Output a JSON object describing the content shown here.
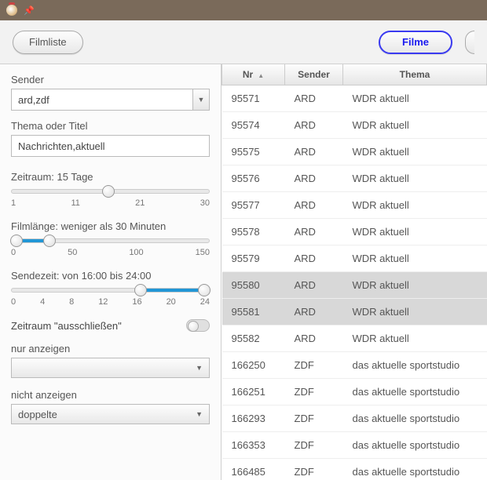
{
  "toolbar": {
    "filmliste_label": "Filmliste",
    "filme_label": "Filme"
  },
  "filters": {
    "sender_label": "Sender",
    "sender_value": "ard,zdf",
    "thema_label": "Thema oder Titel",
    "thema_value": "Nachrichten,aktuell",
    "zeitraum_label": "Zeitraum: 15 Tage",
    "zeitraum_ticks": [
      "1",
      "11",
      "21",
      "30"
    ],
    "filmlaenge_label": "Filmlänge: weniger als 30 Minuten",
    "filmlaenge_ticks": [
      "0",
      "50",
      "100",
      "150"
    ],
    "sendezeit_label": "Sendezeit: von 16:00 bis 24:00",
    "sendezeit_ticks": [
      "0",
      "4",
      "8",
      "12",
      "16",
      "20",
      "24"
    ],
    "exclude_label": "Zeitraum \"ausschließen\"",
    "nur_anzeigen_label": "nur anzeigen",
    "nur_anzeigen_value": "",
    "nicht_anzeigen_label": "nicht anzeigen",
    "nicht_anzeigen_value": "doppelte"
  },
  "table": {
    "headers": {
      "nr": "Nr",
      "sender": "Sender",
      "thema": "Thema"
    },
    "rows": [
      {
        "nr": "95571",
        "sender": "ARD",
        "thema": "WDR aktuell",
        "selected": false
      },
      {
        "nr": "95574",
        "sender": "ARD",
        "thema": "WDR aktuell",
        "selected": false
      },
      {
        "nr": "95575",
        "sender": "ARD",
        "thema": "WDR aktuell",
        "selected": false
      },
      {
        "nr": "95576",
        "sender": "ARD",
        "thema": "WDR aktuell",
        "selected": false
      },
      {
        "nr": "95577",
        "sender": "ARD",
        "thema": "WDR aktuell",
        "selected": false
      },
      {
        "nr": "95578",
        "sender": "ARD",
        "thema": "WDR aktuell",
        "selected": false
      },
      {
        "nr": "95579",
        "sender": "ARD",
        "thema": "WDR aktuell",
        "selected": false
      },
      {
        "nr": "95580",
        "sender": "ARD",
        "thema": "WDR aktuell",
        "selected": true
      },
      {
        "nr": "95581",
        "sender": "ARD",
        "thema": "WDR aktuell",
        "selected": true
      },
      {
        "nr": "95582",
        "sender": "ARD",
        "thema": "WDR aktuell",
        "selected": false
      },
      {
        "nr": "166250",
        "sender": "ZDF",
        "thema": "das aktuelle sportstudio",
        "selected": false
      },
      {
        "nr": "166251",
        "sender": "ZDF",
        "thema": "das aktuelle sportstudio",
        "selected": false
      },
      {
        "nr": "166293",
        "sender": "ZDF",
        "thema": "das aktuelle sportstudio",
        "selected": false
      },
      {
        "nr": "166353",
        "sender": "ZDF",
        "thema": "das aktuelle sportstudio",
        "selected": false
      },
      {
        "nr": "166485",
        "sender": "ZDF",
        "thema": "das aktuelle sportstudio",
        "selected": false
      }
    ]
  }
}
